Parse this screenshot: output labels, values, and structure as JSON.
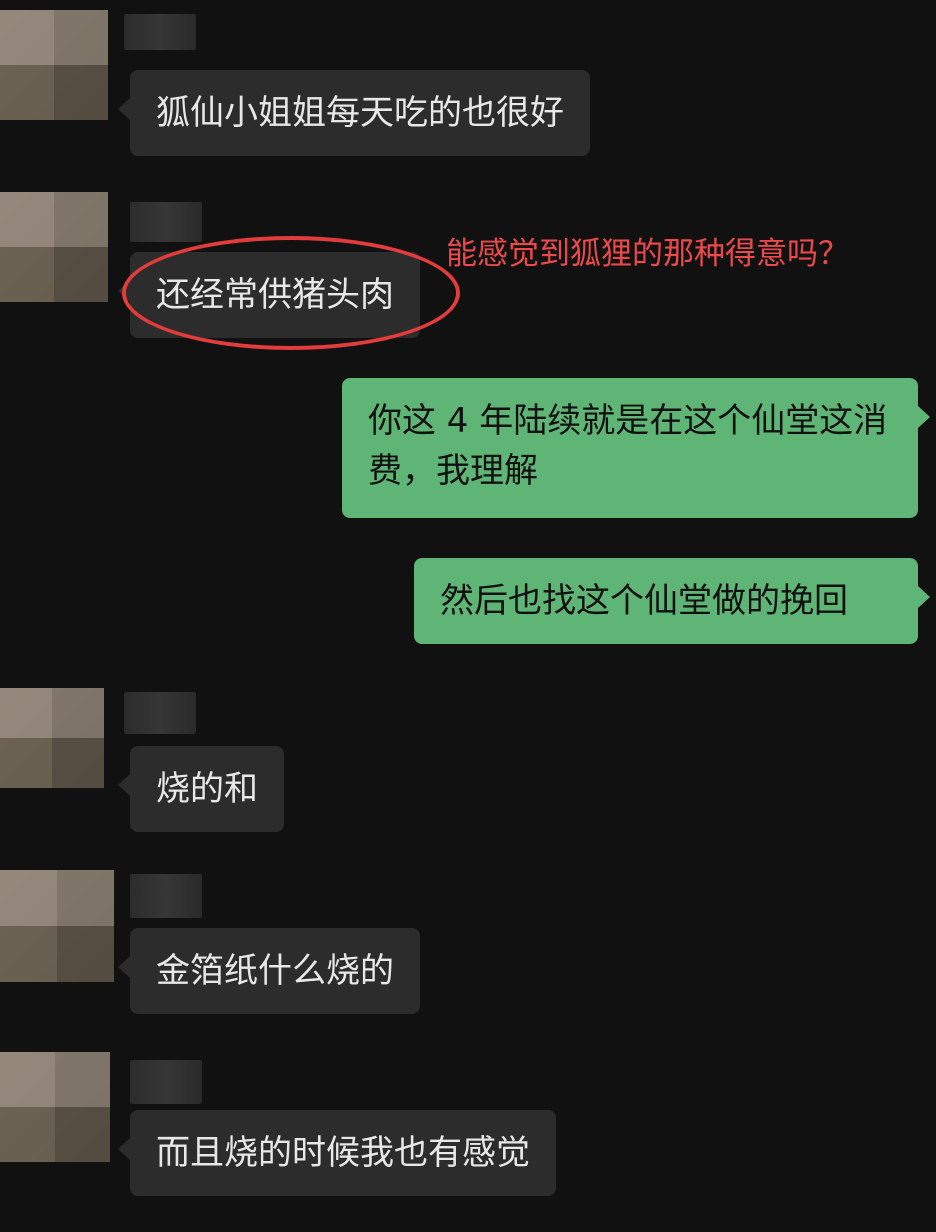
{
  "messages": [
    {
      "side": "incoming",
      "text": "狐仙小姐姐每天吃的也很好"
    },
    {
      "side": "incoming",
      "text": "还经常供猪头肉"
    },
    {
      "side": "outgoing",
      "text": "你这 4 年陆续就是在这个仙堂这消费，我理解"
    },
    {
      "side": "outgoing",
      "text": "然后也找这个仙堂做的挽回"
    },
    {
      "side": "incoming",
      "text": "烧的和"
    },
    {
      "side": "incoming",
      "text": "金箔纸什么烧的"
    },
    {
      "side": "incoming",
      "text": "而且烧的时候我也有感觉"
    }
  ],
  "annotation": {
    "text": "能感觉到狐狸的那种得意吗？",
    "color": "#ec4a4a"
  },
  "colors": {
    "background": "#111111",
    "incoming_bubble": "#2c2c2c",
    "outgoing_bubble": "#5fb576",
    "highlight_circle": "#e23c3c"
  }
}
